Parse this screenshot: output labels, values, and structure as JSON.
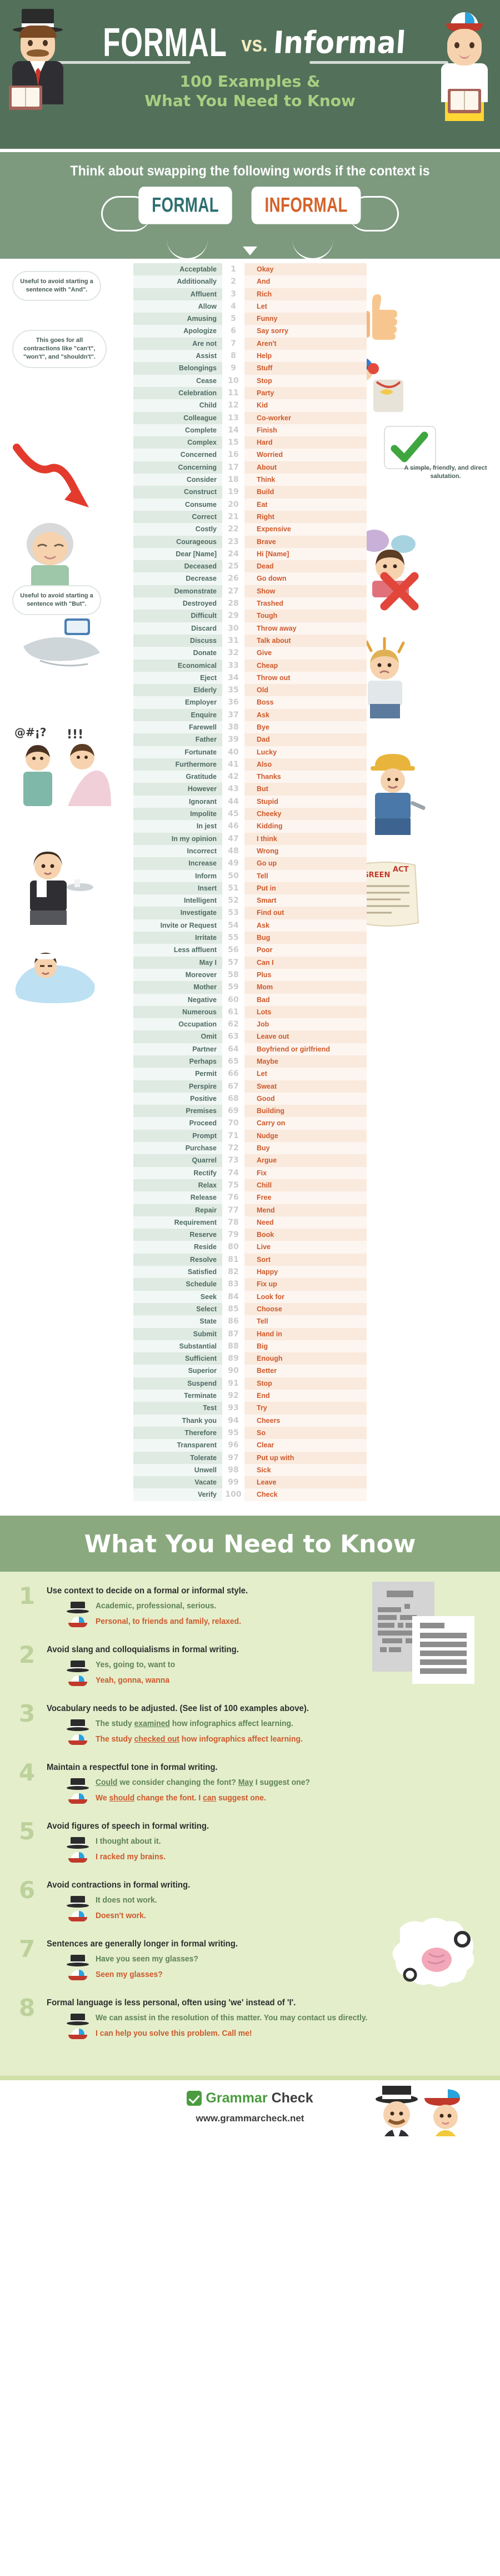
{
  "header": {
    "title_formal": "FORMAL",
    "title_vs": "vs.",
    "title_informal": "Informal",
    "subtitle_line1": "100 Examples &",
    "subtitle_line2": "What You Need to Know",
    "formal_character": "gentleman-top-hat-reading-book",
    "informal_character": "boy-baseball-cap-reading-book"
  },
  "intro": {
    "prompt": "Think about swapping the following words if the context is",
    "pill_formal": "FORMAL",
    "pill_informal": "INFORMAL"
  },
  "list": {
    "notes": [
      {
        "text": "Useful to avoid starting a sentence with \"And\"."
      },
      {
        "text": "This goes for all contractions like \"can't\", \"won't\", and \"shouldn't\"."
      },
      {
        "text": "Useful to avoid starting a sentence with \"But\"."
      },
      {
        "text": "A simple, friendly, and direct salutation."
      }
    ],
    "pairs": [
      {
        "n": 1,
        "formal": "Acceptable",
        "informal": "Okay"
      },
      {
        "n": 2,
        "formal": "Additionally",
        "informal": "And"
      },
      {
        "n": 3,
        "formal": "Affluent",
        "informal": "Rich"
      },
      {
        "n": 4,
        "formal": "Allow",
        "informal": "Let"
      },
      {
        "n": 5,
        "formal": "Amusing",
        "informal": "Funny"
      },
      {
        "n": 6,
        "formal": "Apologize",
        "informal": "Say sorry"
      },
      {
        "n": 7,
        "formal": "Are not",
        "informal": "Aren't"
      },
      {
        "n": 8,
        "formal": "Assist",
        "informal": "Help"
      },
      {
        "n": 9,
        "formal": "Belongings",
        "informal": "Stuff"
      },
      {
        "n": 10,
        "formal": "Cease",
        "informal": "Stop"
      },
      {
        "n": 11,
        "formal": "Celebration",
        "informal": "Party"
      },
      {
        "n": 12,
        "formal": "Child",
        "informal": "Kid"
      },
      {
        "n": 13,
        "formal": "Colleague",
        "informal": "Co-worker"
      },
      {
        "n": 14,
        "formal": "Complete",
        "informal": "Finish"
      },
      {
        "n": 15,
        "formal": "Complex",
        "informal": "Hard"
      },
      {
        "n": 16,
        "formal": "Concerned",
        "informal": "Worried"
      },
      {
        "n": 17,
        "formal": "Concerning",
        "informal": "About"
      },
      {
        "n": 18,
        "formal": "Consider",
        "informal": "Think"
      },
      {
        "n": 19,
        "formal": "Construct",
        "informal": "Build"
      },
      {
        "n": 20,
        "formal": "Consume",
        "informal": "Eat"
      },
      {
        "n": 21,
        "formal": "Correct",
        "informal": "Right"
      },
      {
        "n": 22,
        "formal": "Costly",
        "informal": "Expensive"
      },
      {
        "n": 23,
        "formal": "Courageous",
        "informal": "Brave"
      },
      {
        "n": 24,
        "formal": "Dear [Name]",
        "informal": "Hi [Name]"
      },
      {
        "n": 25,
        "formal": "Deceased",
        "informal": "Dead"
      },
      {
        "n": 26,
        "formal": "Decrease",
        "informal": "Go down"
      },
      {
        "n": 27,
        "formal": "Demonstrate",
        "informal": "Show"
      },
      {
        "n": 28,
        "formal": "Destroyed",
        "informal": "Trashed"
      },
      {
        "n": 29,
        "formal": "Difficult",
        "informal": "Tough"
      },
      {
        "n": 30,
        "formal": "Discard",
        "informal": "Throw away"
      },
      {
        "n": 31,
        "formal": "Discuss",
        "informal": "Talk about"
      },
      {
        "n": 32,
        "formal": "Donate",
        "informal": "Give"
      },
      {
        "n": 33,
        "formal": "Economical",
        "informal": "Cheap"
      },
      {
        "n": 34,
        "formal": "Eject",
        "informal": "Throw out"
      },
      {
        "n": 35,
        "formal": "Elderly",
        "informal": "Old"
      },
      {
        "n": 36,
        "formal": "Employer",
        "informal": "Boss"
      },
      {
        "n": 37,
        "formal": "Enquire",
        "informal": "Ask"
      },
      {
        "n": 38,
        "formal": "Farewell",
        "informal": "Bye"
      },
      {
        "n": 39,
        "formal": "Father",
        "informal": "Dad"
      },
      {
        "n": 40,
        "formal": "Fortunate",
        "informal": "Lucky"
      },
      {
        "n": 41,
        "formal": "Furthermore",
        "informal": "Also"
      },
      {
        "n": 42,
        "formal": "Gratitude",
        "informal": "Thanks"
      },
      {
        "n": 43,
        "formal": "However",
        "informal": "But"
      },
      {
        "n": 44,
        "formal": "Ignorant",
        "informal": "Stupid"
      },
      {
        "n": 45,
        "formal": "Impolite",
        "informal": "Cheeky"
      },
      {
        "n": 46,
        "formal": "In jest",
        "informal": "Kidding"
      },
      {
        "n": 47,
        "formal": "In my opinion",
        "informal": "I think"
      },
      {
        "n": 48,
        "formal": "Incorrect",
        "informal": "Wrong"
      },
      {
        "n": 49,
        "formal": "Increase",
        "informal": "Go up"
      },
      {
        "n": 50,
        "formal": "Inform",
        "informal": "Tell"
      },
      {
        "n": 51,
        "formal": "Insert",
        "informal": "Put in"
      },
      {
        "n": 52,
        "formal": "Intelligent",
        "informal": "Smart"
      },
      {
        "n": 53,
        "formal": "Investigate",
        "informal": "Find out"
      },
      {
        "n": 54,
        "formal": "Invite or Request",
        "informal": "Ask"
      },
      {
        "n": 55,
        "formal": "Irritate",
        "informal": "Bug"
      },
      {
        "n": 56,
        "formal": "Less affluent",
        "informal": "Poor"
      },
      {
        "n": 57,
        "formal": "May I",
        "informal": "Can I"
      },
      {
        "n": 58,
        "formal": "Moreover",
        "informal": "Plus"
      },
      {
        "n": 59,
        "formal": "Mother",
        "informal": "Mom"
      },
      {
        "n": 60,
        "formal": "Negative",
        "informal": "Bad"
      },
      {
        "n": 61,
        "formal": "Numerous",
        "informal": "Lots"
      },
      {
        "n": 62,
        "formal": "Occupation",
        "informal": "Job"
      },
      {
        "n": 63,
        "formal": "Omit",
        "informal": "Leave out"
      },
      {
        "n": 64,
        "formal": "Partner",
        "informal": "Boyfriend or girlfriend"
      },
      {
        "n": 65,
        "formal": "Perhaps",
        "informal": "Maybe"
      },
      {
        "n": 66,
        "formal": "Permit",
        "informal": "Let"
      },
      {
        "n": 67,
        "formal": "Perspire",
        "informal": "Sweat"
      },
      {
        "n": 68,
        "formal": "Positive",
        "informal": "Good"
      },
      {
        "n": 69,
        "formal": "Premises",
        "informal": "Building"
      },
      {
        "n": 70,
        "formal": "Proceed",
        "informal": "Carry on"
      },
      {
        "n": 71,
        "formal": "Prompt",
        "informal": "Nudge"
      },
      {
        "n": 72,
        "formal": "Purchase",
        "informal": "Buy"
      },
      {
        "n": 73,
        "formal": "Quarrel",
        "informal": "Argue"
      },
      {
        "n": 74,
        "formal": "Rectify",
        "informal": "Fix"
      },
      {
        "n": 75,
        "formal": "Relax",
        "informal": "Chill"
      },
      {
        "n": 76,
        "formal": "Release",
        "informal": "Free"
      },
      {
        "n": 77,
        "formal": "Repair",
        "informal": "Mend"
      },
      {
        "n": 78,
        "formal": "Requirement",
        "informal": "Need"
      },
      {
        "n": 79,
        "formal": "Reserve",
        "informal": "Book"
      },
      {
        "n": 80,
        "formal": "Reside",
        "informal": "Live"
      },
      {
        "n": 81,
        "formal": "Resolve",
        "informal": "Sort"
      },
      {
        "n": 82,
        "formal": "Satisfied",
        "informal": "Happy"
      },
      {
        "n": 83,
        "formal": "Schedule",
        "informal": "Fix up"
      },
      {
        "n": 84,
        "formal": "Seek",
        "informal": "Look for"
      },
      {
        "n": 85,
        "formal": "Select",
        "informal": "Choose"
      },
      {
        "n": 86,
        "formal": "State",
        "informal": "Tell"
      },
      {
        "n": 87,
        "formal": "Submit",
        "informal": "Hand in"
      },
      {
        "n": 88,
        "formal": "Substantial",
        "informal": "Big"
      },
      {
        "n": 89,
        "formal": "Sufficient",
        "informal": "Enough"
      },
      {
        "n": 90,
        "formal": "Superior",
        "informal": "Better"
      },
      {
        "n": 91,
        "formal": "Suspend",
        "informal": "Stop"
      },
      {
        "n": 92,
        "formal": "Terminate",
        "informal": "End"
      },
      {
        "n": 93,
        "formal": "Test",
        "informal": "Try"
      },
      {
        "n": 94,
        "formal": "Thank you",
        "informal": "Cheers"
      },
      {
        "n": 95,
        "formal": "Therefore",
        "informal": "So"
      },
      {
        "n": 96,
        "formal": "Transparent",
        "informal": "Clear"
      },
      {
        "n": 97,
        "formal": "Tolerate",
        "informal": "Put up with"
      },
      {
        "n": 98,
        "formal": "Unwell",
        "informal": "Sick"
      },
      {
        "n": 99,
        "formal": "Vacate",
        "informal": "Leave"
      },
      {
        "n": 100,
        "formal": "Verify",
        "informal": "Check"
      }
    ]
  },
  "wynk": {
    "title": "What You Need to Know",
    "tips": [
      {
        "num": "1",
        "head": "Use context to decide on a formal or informal style.",
        "formal": "Academic, professional, serious.",
        "informal": "Personal, to friends and family, relaxed."
      },
      {
        "num": "2",
        "head": "Avoid slang and colloquialisms in formal writing.",
        "formal": "Yes, going to, want to",
        "informal": "Yeah, gonna, wanna"
      },
      {
        "num": "3",
        "head": "Vocabulary needs to be adjusted. (See list of 100 examples above).",
        "formal_pre": "The study ",
        "formal_u": "examined",
        "formal_post": " how infographics affect learning.",
        "informal_pre": "The study ",
        "informal_u": "checked out",
        "informal_post": " how infographics affect learning."
      },
      {
        "num": "4",
        "head": "Maintain a respectful tone in formal writing.",
        "formal_u": "Could",
        "formal_mid": " we consider changing the font? ",
        "formal_u2": "May",
        "formal_post": " I suggest one?",
        "informal_pre": "We ",
        "informal_u": "should",
        "informal_mid": " change the font. I ",
        "informal_u2": "can",
        "informal_post": " suggest one."
      },
      {
        "num": "5",
        "head": "Avoid figures of speech in formal writing.",
        "formal": "I thought about it.",
        "informal": "I racked my brains."
      },
      {
        "num": "6",
        "head": "Avoid contractions in formal writing.",
        "formal": "It does not work.",
        "informal": "Doesn't work."
      },
      {
        "num": "7",
        "head": "Sentences are generally longer in formal writing.",
        "formal": "Have you seen my glasses?",
        "informal": "Seen my glasses?"
      },
      {
        "num": "8",
        "head": "Formal language is less personal, often using 'we' instead of 'I'.",
        "formal": "We can assist in the resolution of this matter. You may contact us directly.",
        "informal": "I can help you solve this problem. Call me!"
      }
    ]
  },
  "footer": {
    "logo_part1": "Grammar",
    "logo_part2": "Check",
    "url": "www.grammarcheck.net"
  }
}
